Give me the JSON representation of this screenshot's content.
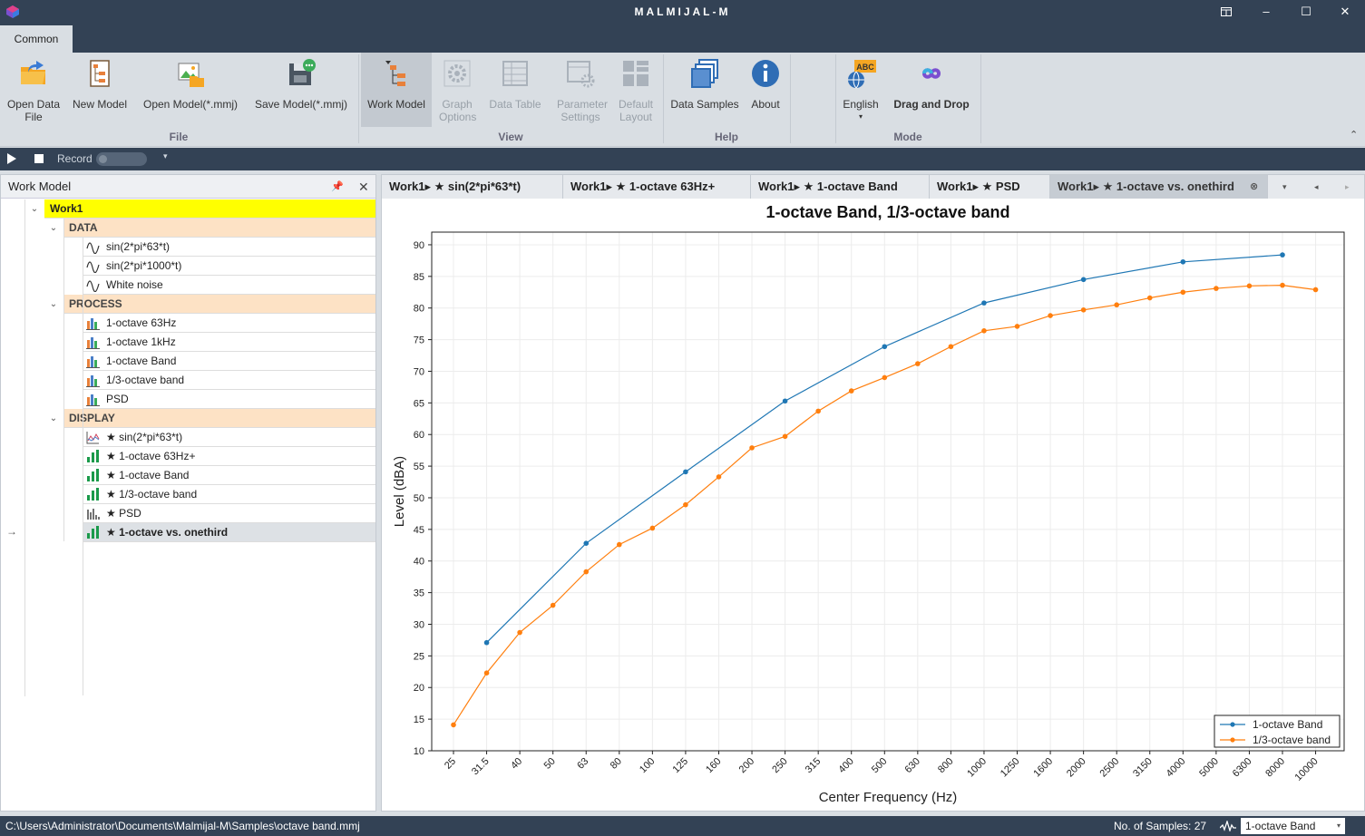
{
  "window": {
    "title": "MALMIJAL-M"
  },
  "ribbon_tab": "Common",
  "ribbon": {
    "buttons": [
      {
        "label": "Open Data File",
        "icon": "open-folder-icon",
        "enabled": true
      },
      {
        "label": "New Model",
        "icon": "new-model-icon",
        "enabled": true
      },
      {
        "label": "Open Model(*.mmj)",
        "icon": "open-model-icon",
        "enabled": true
      },
      {
        "label": "Save Model(*.mmj)",
        "icon": "save-model-icon",
        "enabled": true
      },
      {
        "label": "Work Model",
        "icon": "work-model-icon",
        "enabled": true,
        "selected": true
      },
      {
        "label": "Graph Options",
        "icon": "gear-icon",
        "enabled": false
      },
      {
        "label": "Data Table",
        "icon": "table-icon",
        "enabled": false
      },
      {
        "label": "Parameter Settings",
        "icon": "settings-icon",
        "enabled": false
      },
      {
        "label": "Default Layout",
        "icon": "layout-icon",
        "enabled": false
      },
      {
        "label": "Data Samples",
        "icon": "samples-icon",
        "enabled": true
      },
      {
        "label": "About",
        "icon": "info-icon",
        "enabled": true
      },
      {
        "label": "English",
        "icon": "language-icon",
        "enabled": true
      },
      {
        "label": "Drag and Drop",
        "icon": "infinity-icon",
        "enabled": true
      }
    ],
    "groups": [
      "File",
      "View",
      "Help",
      "Mode"
    ]
  },
  "toolbar": {
    "record_label": "Record"
  },
  "work_model": {
    "title": "Work Model",
    "root": "Work1",
    "sections": [
      {
        "name": "DATA",
        "items": [
          "sin(2*pi*63*t)",
          "sin(2*pi*1000*t)",
          "White noise"
        ]
      },
      {
        "name": "PROCESS",
        "items": [
          "1-octave 63Hz",
          "1-octave 1kHz",
          "1-octave Band",
          "1/3-octave band",
          "PSD"
        ]
      },
      {
        "name": "DISPLAY",
        "items": [
          "★ sin(2*pi*63*t)",
          "★ 1-octave 63Hz+",
          "★ 1-octave Band",
          "★ 1/3-octave band",
          "★ PSD",
          "★ 1-octave vs. onethird"
        ]
      }
    ]
  },
  "doc_tabs": [
    "Work1▸ ★ sin(2*pi*63*t)",
    "Work1▸ ★ 1-octave 63Hz+",
    "Work1▸ ★ 1-octave Band",
    "Work1▸ ★ PSD",
    "Work1▸ ★ 1-octave vs. onethird"
  ],
  "chart_data": {
    "type": "line",
    "title": "1-octave Band, 1/3-octave band",
    "xlabel": "Center Frequency (Hz)",
    "ylabel": "Level (dBA)",
    "categories": [
      "25",
      "31.5",
      "40",
      "50",
      "63",
      "80",
      "100",
      "125",
      "160",
      "200",
      "250",
      "315",
      "400",
      "500",
      "630",
      "800",
      "1000",
      "1250",
      "1600",
      "2000",
      "2500",
      "3150",
      "4000",
      "5000",
      "6300",
      "8000",
      "10000"
    ],
    "ylim": [
      10,
      92
    ],
    "yticks": [
      10,
      15,
      20,
      25,
      30,
      35,
      40,
      45,
      50,
      55,
      60,
      65,
      70,
      75,
      80,
      85,
      90
    ],
    "grid": true,
    "legend_position": "bottom-right",
    "series": [
      {
        "name": "1-octave Band",
        "color": "#1f77b4",
        "values": [
          null,
          27.1,
          null,
          null,
          42.8,
          null,
          null,
          54.1,
          null,
          null,
          65.3,
          null,
          null,
          73.9,
          null,
          null,
          80.8,
          null,
          null,
          84.5,
          null,
          null,
          87.3,
          null,
          null,
          88.4,
          null
        ]
      },
      {
        "name": "1/3-octave band",
        "color": "#ff7f0e",
        "values": [
          14.1,
          22.3,
          28.7,
          33.0,
          38.3,
          42.6,
          45.2,
          48.9,
          53.3,
          57.9,
          59.7,
          63.7,
          66.9,
          69.0,
          71.2,
          73.9,
          76.4,
          77.1,
          78.8,
          79.7,
          80.5,
          81.6,
          82.5,
          83.1,
          83.5,
          83.6,
          82.9
        ]
      }
    ]
  },
  "status": {
    "path": "C:\\Users\\Administrator\\Documents\\Malmijal-M\\Samples\\octave band.mmj",
    "samples": "No. of Samples: 27",
    "selection": "1-octave Band"
  }
}
